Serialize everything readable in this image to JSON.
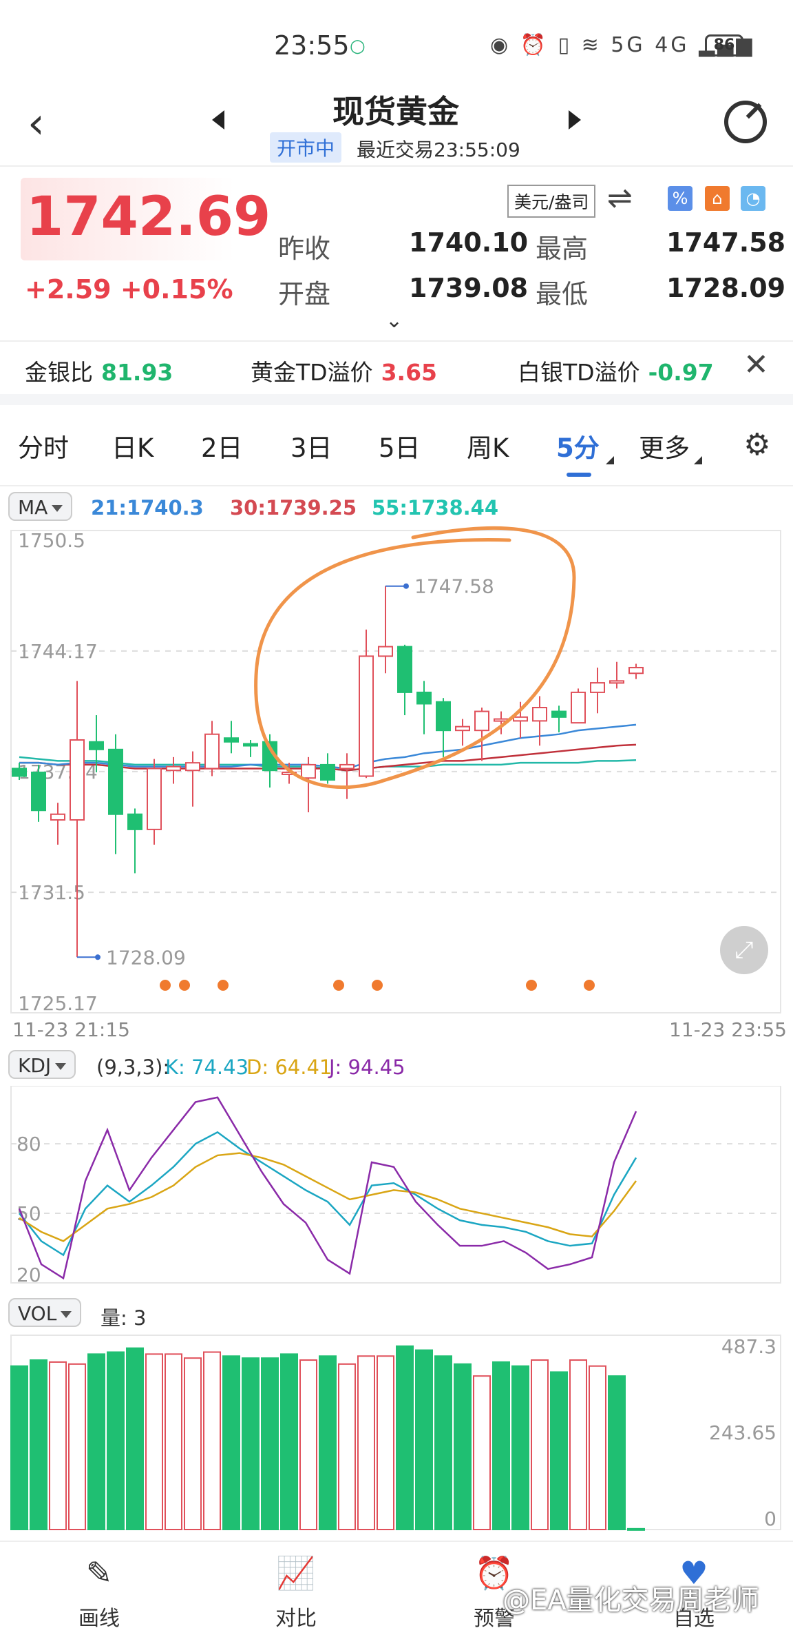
{
  "status_bar": {
    "time": "23:55",
    "battery": "86",
    "signal_text": "5G 4G"
  },
  "header": {
    "title": "现货黄金",
    "market_status": "开市中",
    "last_trade": "最近交易23:55:09"
  },
  "quote": {
    "price": "1742.69",
    "change": "+2.59",
    "change_pct": "+0.15%",
    "unit_button": "美元/盎司",
    "prev_close_label": "昨收",
    "prev_close": "1740.10",
    "high_label": "最高",
    "high": "1747.58",
    "open_label": "开盘",
    "open": "1739.08",
    "low_label": "最低",
    "low": "1728.09"
  },
  "ratios": [
    {
      "label": "金银比",
      "value": "81.93",
      "color": "#1fb56d"
    },
    {
      "label": "黄金TD溢价",
      "value": "3.65",
      "color": "#e8414b"
    },
    {
      "label": "白银TD溢价",
      "value": "-0.97",
      "color": "#1fb56d"
    }
  ],
  "tabs": [
    {
      "label": "分时",
      "active": false
    },
    {
      "label": "日K",
      "active": false
    },
    {
      "label": "2日",
      "active": false
    },
    {
      "label": "3日",
      "active": false
    },
    {
      "label": "5日",
      "active": false
    },
    {
      "label": "周K",
      "active": false
    },
    {
      "label": "5分",
      "active": true
    },
    {
      "label": "更多",
      "active": false
    }
  ],
  "ma": {
    "selector": "MA",
    "ma21": "21:1740.3",
    "ma30": "30:1739.25",
    "ma55": "55:1738.44",
    "colors": {
      "ma21": "#3a88d8",
      "ma30": "#c0303a",
      "ma55": "#22b8a8"
    }
  },
  "kdj": {
    "selector": "KDJ",
    "params": "(9,3,3):",
    "k": "K: 74.43",
    "d": "D: 64.41",
    "j": "J: 94.45",
    "colors": {
      "k": "#1ba6c2",
      "d": "#d9a514",
      "j": "#8a2aa8"
    }
  },
  "vol": {
    "selector": "VOL",
    "amount": "量: 3"
  },
  "time_axis": {
    "start": "11-23 21:15",
    "end": "11-23 23:55"
  },
  "chart_data": [
    {
      "type": "candlestick",
      "title": "",
      "ylim": [
        1725.17,
        1750.5
      ],
      "ytick_labels": [
        "1750.5",
        "1744.17",
        "1737.84",
        "1731.5",
        "1725.17"
      ],
      "annotations": [
        {
          "label": "1747.58",
          "value": 1747.58
        },
        {
          "label": "1728.09",
          "value": 1728.09
        }
      ],
      "candles": [
        {
          "o": 1738.0,
          "c": 1737.6,
          "h": 1738.3,
          "l": 1737.4
        },
        {
          "o": 1737.8,
          "c": 1735.8,
          "h": 1738.2,
          "l": 1735.2
        },
        {
          "o": 1735.3,
          "c": 1735.6,
          "h": 1736.2,
          "l": 1734.0
        },
        {
          "o": 1735.3,
          "c": 1739.5,
          "h": 1742.6,
          "l": 1728.09
        },
        {
          "o": 1739.4,
          "c": 1739.0,
          "h": 1740.8,
          "l": 1737.8
        },
        {
          "o": 1739.0,
          "c": 1735.6,
          "h": 1739.8,
          "l": 1733.5
        },
        {
          "o": 1735.6,
          "c": 1734.8,
          "h": 1735.9,
          "l": 1732.5
        },
        {
          "o": 1734.8,
          "c": 1738.0,
          "h": 1738.5,
          "l": 1734.0
        },
        {
          "o": 1737.9,
          "c": 1738.1,
          "h": 1738.6,
          "l": 1737.2
        },
        {
          "o": 1737.9,
          "c": 1738.3,
          "h": 1738.9,
          "l": 1736.0
        },
        {
          "o": 1738.0,
          "c": 1739.8,
          "h": 1740.5,
          "l": 1737.6
        },
        {
          "o": 1739.6,
          "c": 1739.4,
          "h": 1740.5,
          "l": 1738.8
        },
        {
          "o": 1739.3,
          "c": 1739.2,
          "h": 1739.5,
          "l": 1738.6
        },
        {
          "o": 1739.4,
          "c": 1737.9,
          "h": 1739.8,
          "l": 1737.0
        },
        {
          "o": 1737.8,
          "c": 1737.8,
          "h": 1738.3,
          "l": 1737.2
        },
        {
          "o": 1737.5,
          "c": 1738.2,
          "h": 1738.6,
          "l": 1735.7
        },
        {
          "o": 1738.2,
          "c": 1737.4,
          "h": 1738.8,
          "l": 1737.2
        },
        {
          "o": 1738.0,
          "c": 1738.2,
          "h": 1738.8,
          "l": 1736.4
        },
        {
          "o": 1737.6,
          "c": 1743.9,
          "h": 1745.3,
          "l": 1737.5
        },
        {
          "o": 1743.9,
          "c": 1744.4,
          "h": 1747.58,
          "l": 1743.0
        },
        {
          "o": 1744.4,
          "c": 1742.0,
          "h": 1744.5,
          "l": 1740.8
        },
        {
          "o": 1742.0,
          "c": 1741.4,
          "h": 1742.6,
          "l": 1739.8
        },
        {
          "o": 1741.5,
          "c": 1740.0,
          "h": 1741.7,
          "l": 1738.6
        },
        {
          "o": 1740.0,
          "c": 1740.2,
          "h": 1740.6,
          "l": 1739.2
        },
        {
          "o": 1740.0,
          "c": 1741.0,
          "h": 1741.2,
          "l": 1738.4
        },
        {
          "o": 1740.6,
          "c": 1740.6,
          "h": 1741.0,
          "l": 1739.8
        },
        {
          "o": 1740.5,
          "c": 1740.7,
          "h": 1741.5,
          "l": 1739.6
        },
        {
          "o": 1740.5,
          "c": 1741.2,
          "h": 1741.8,
          "l": 1739.2
        },
        {
          "o": 1741.0,
          "c": 1740.7,
          "h": 1741.3,
          "l": 1739.9
        },
        {
          "o": 1740.4,
          "c": 1742.0,
          "h": 1742.2,
          "l": 1740.4
        },
        {
          "o": 1742.0,
          "c": 1742.5,
          "h": 1743.3,
          "l": 1740.9
        },
        {
          "o": 1742.6,
          "c": 1742.6,
          "h": 1743.6,
          "l": 1742.2
        },
        {
          "o": 1743.0,
          "c": 1743.3,
          "h": 1743.5,
          "l": 1742.7
        }
      ],
      "ma_lines": {
        "ma21": [
          1738.3,
          1738.3,
          1738.2,
          1738.3,
          1738.3,
          1738.2,
          1738.1,
          1738.1,
          1738.1,
          1738.1,
          1738.1,
          1738.1,
          1738.2,
          1738.2,
          1738.2,
          1738.2,
          1738.1,
          1738.0,
          1738.3,
          1738.5,
          1738.6,
          1738.8,
          1738.9,
          1739.0,
          1739.2,
          1739.4,
          1739.6,
          1739.7,
          1739.8,
          1740.0,
          1740.1,
          1740.2,
          1740.3
        ],
        "ma30": [
          1738.3,
          1738.3,
          1738.2,
          1738.2,
          1738.2,
          1738.1,
          1738.0,
          1738.0,
          1738.0,
          1738.0,
          1738.0,
          1738.0,
          1738.0,
          1738.0,
          1738.0,
          1738.0,
          1738.0,
          1737.9,
          1738.0,
          1738.1,
          1738.2,
          1738.3,
          1738.4,
          1738.4,
          1738.5,
          1738.6,
          1738.7,
          1738.8,
          1738.9,
          1739.0,
          1739.1,
          1739.2,
          1739.25
        ],
        "ma55": [
          1738.6,
          1738.5,
          1738.4,
          1738.4,
          1738.4,
          1738.3,
          1738.2,
          1738.2,
          1738.2,
          1738.2,
          1738.2,
          1738.2,
          1738.2,
          1738.1,
          1738.1,
          1738.1,
          1738.0,
          1737.9,
          1738.0,
          1738.1,
          1738.1,
          1738.1,
          1738.2,
          1738.2,
          1738.2,
          1738.2,
          1738.3,
          1738.3,
          1738.3,
          1738.3,
          1738.4,
          1738.4,
          1738.44
        ]
      },
      "signal_markers_at_index": [
        8,
        9,
        11,
        17,
        19,
        27,
        30
      ]
    },
    {
      "type": "line",
      "title": "KDJ",
      "ylim": [
        20,
        105
      ],
      "ytick_labels": [
        "80",
        "50",
        "20"
      ],
      "series": [
        {
          "name": "K",
          "values": [
            50,
            38,
            32,
            52,
            62,
            55,
            62,
            70,
            80,
            85,
            78,
            72,
            66,
            60,
            55,
            45,
            62,
            63,
            58,
            52,
            47,
            45,
            44,
            42,
            38,
            36,
            37,
            58,
            74
          ]
        },
        {
          "name": "D",
          "values": [
            48,
            42,
            38,
            45,
            52,
            54,
            57,
            62,
            70,
            75,
            76,
            74,
            71,
            66,
            61,
            56,
            58,
            60,
            59,
            56,
            52,
            50,
            48,
            46,
            44,
            41,
            40,
            51,
            64
          ]
        },
        {
          "name": "J",
          "values": [
            52,
            28,
            22,
            64,
            86,
            60,
            74,
            86,
            98,
            100,
            84,
            68,
            54,
            46,
            30,
            24,
            72,
            70,
            55,
            45,
            36,
            36,
            38,
            33,
            26,
            28,
            31,
            72,
            94
          ]
        }
      ]
    },
    {
      "type": "bar",
      "title": "VOL",
      "ylim": [
        0,
        487.3
      ],
      "ytick_labels": [
        "487.3",
        "243.65",
        "0"
      ],
      "values": [
        410,
        425,
        420,
        415,
        440,
        445,
        455,
        440,
        440,
        430,
        445,
        435,
        430,
        430,
        440,
        425,
        435,
        415,
        435,
        435,
        460,
        450,
        435,
        415,
        385,
        420,
        410,
        425,
        395,
        425,
        410,
        385,
        2
      ],
      "rising": [
        false,
        false,
        true,
        true,
        false,
        false,
        false,
        true,
        true,
        true,
        true,
        false,
        false,
        false,
        false,
        true,
        false,
        true,
        true,
        true,
        false,
        false,
        false,
        false,
        true,
        false,
        false,
        true,
        false,
        true,
        true,
        false,
        false
      ]
    }
  ],
  "bottom_nav": [
    {
      "label": "画线",
      "icon": "pen-icon"
    },
    {
      "label": "对比",
      "icon": "compare-chart-icon"
    },
    {
      "label": "预警",
      "icon": "alarm-icon"
    },
    {
      "label": "自选",
      "icon": "heart-icon"
    }
  ],
  "watermark": "@EA量化交易周老师"
}
